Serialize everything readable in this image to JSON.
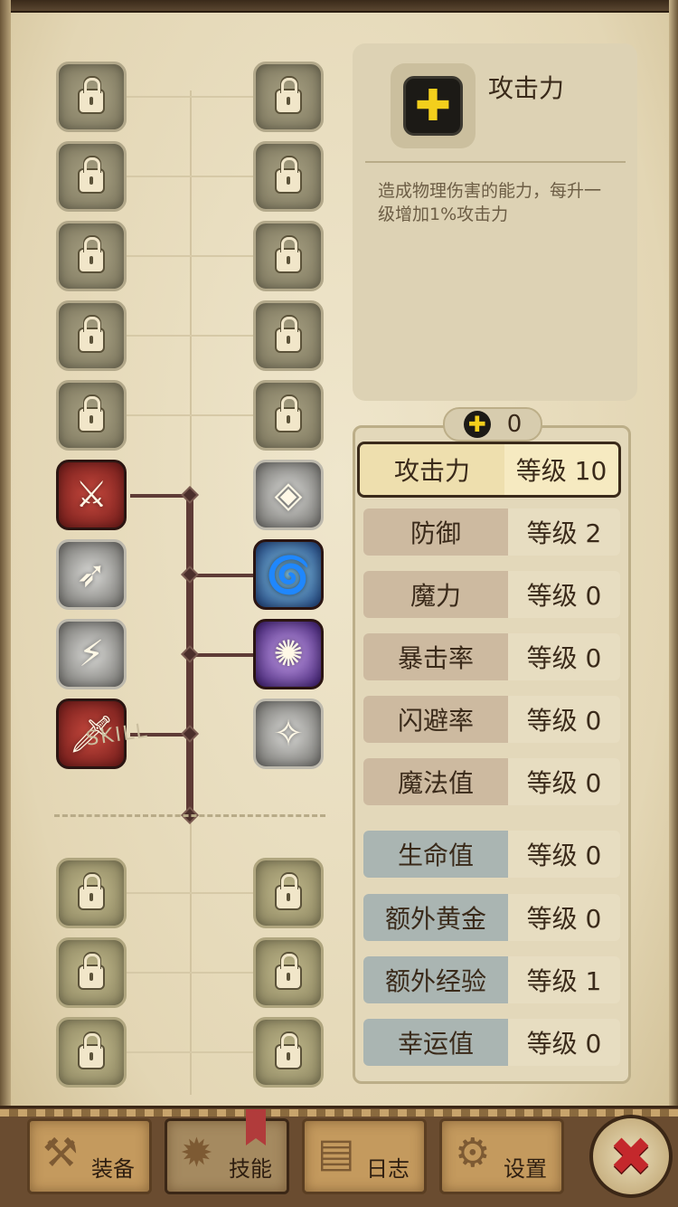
{
  "info": {
    "title": "攻击力",
    "icon": "plus-icon",
    "description": "造成物理伤害的能力，每升一级增加1%攻击力"
  },
  "points": {
    "icon": "plus-icon",
    "value": "0"
  },
  "stats": [
    {
      "name": "攻击力",
      "level": "等级 10",
      "style": "selected"
    },
    {
      "name": "防御",
      "level": "等级 2",
      "style": "brown"
    },
    {
      "name": "魔力",
      "level": "等级 0",
      "style": "brown"
    },
    {
      "name": "暴击率",
      "level": "等级 0",
      "style": "brown"
    },
    {
      "name": "闪避率",
      "level": "等级 0",
      "style": "brown"
    },
    {
      "name": "魔法值",
      "level": "等级 0",
      "style": "brown"
    },
    {
      "name": "生命值",
      "level": "等级 0",
      "style": "blue"
    },
    {
      "name": "额外黄金",
      "level": "等级 0",
      "style": "blue"
    },
    {
      "name": "额外经验",
      "level": "等级 1",
      "style": "blue"
    },
    {
      "name": "幸运值",
      "level": "等级 0",
      "style": "blue"
    }
  ],
  "skill_tree": {
    "label": "SKILL"
  },
  "nav": {
    "tabs": [
      {
        "label": "装备",
        "icon": "axe-icon"
      },
      {
        "label": "技能",
        "icon": "skill-icon"
      },
      {
        "label": "日志",
        "icon": "journal-icon"
      },
      {
        "label": "设置",
        "icon": "gear-icon"
      }
    ],
    "close_icon": "close-icon"
  },
  "colors": {
    "accent_yellow": "#f3cf1c",
    "selected_border": "#3a2a1a",
    "brown_row": "#cdbaa0",
    "blue_row": "#aab5b2",
    "close_red": "#c4282c"
  }
}
